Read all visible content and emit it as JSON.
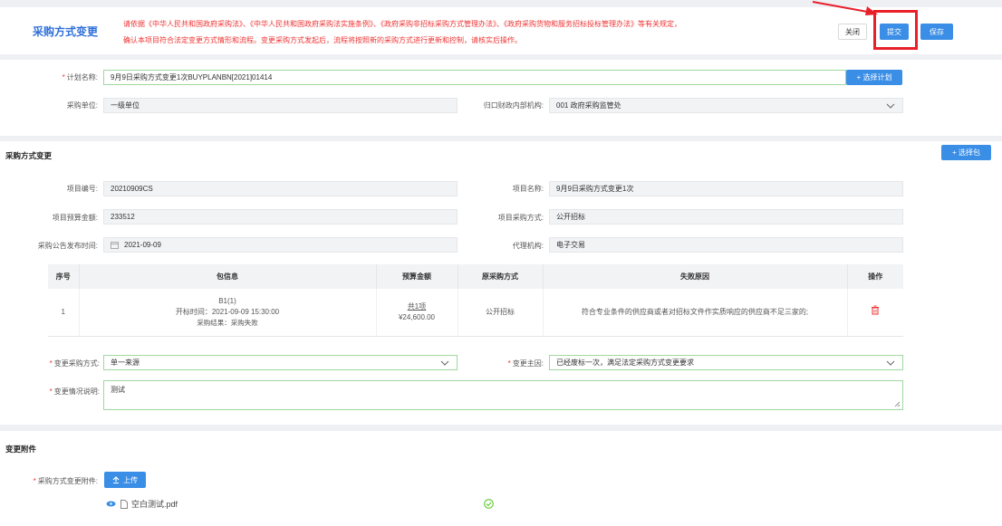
{
  "header": {
    "title": "采购方式变更",
    "notice_line1": "请依据《中华人民共和国政府采购法》、《中华人民共和国政府采购法实施条例》、《政府采购非招标采购方式管理办法》、《政府采购货物和服务招标投标管理办法》等有关规定，",
    "notice_line2": "确认本项目符合法定变更方式情形和流程。变更采购方式发起后，流程将按照新的采购方式进行更新和控制，请核实后操作。",
    "close_label": "关闭",
    "submit_label": "提交",
    "save_label": "保存"
  },
  "plan": {
    "name_label": "计划名称:",
    "name_value": "9月9日采购方式变更1次BUYPLANBN[2021]01414",
    "select_plan_label": "+ 选择计划",
    "unit_label": "采购单位:",
    "unit_value": "一级单位",
    "finance_label": "归口财政内部机构:",
    "finance_value": "001 政府采购监管处"
  },
  "change": {
    "section_title": "采购方式变更",
    "select_package_label": "+ 选择包",
    "project_no_label": "项目编号:",
    "project_no_value": "20210909CS",
    "project_name_label": "项目名称:",
    "project_name_value": "9月9日采购方式变更1次",
    "budget_label": "项目预算金额:",
    "budget_value": "233512",
    "method_label": "项目采购方式:",
    "method_value": "公开招标",
    "publish_label": "采购公告发布时间:",
    "publish_value": "2021-09-09",
    "agency_label": "代理机构:",
    "agency_value": "电子交易",
    "table": {
      "headers": [
        "序号",
        "包信息",
        "预算金额",
        "原采购方式",
        "失败原因",
        "操作"
      ],
      "row": {
        "index": "1",
        "pkg_name": "B1(1)",
        "pkg_open": "开标时间：2021-09-09 15:30:00",
        "pkg_result": "采购结果：采购失败",
        "budget_link": "共1项",
        "budget_amount": "¥24,600.00",
        "orig_method": "公开招标",
        "fail_reason": "符合专业条件的供应商或者对招标文件作实质响应的供应商不足三家的;"
      }
    },
    "new_method_label": "变更采购方式:",
    "new_method_value": "单一来源",
    "reason_label": "变更主因:",
    "reason_value": "已经废标一次，满足法定采购方式变更要求",
    "desc_label": "变更情况说明:",
    "desc_value": "测试"
  },
  "attachment": {
    "section_title": "变更附件",
    "upload_field_label": "采购方式变更附件:",
    "upload_label": "上传",
    "file_name": "空白测试.pdf"
  },
  "colors": {
    "primary": "#3a8ee6",
    "danger": "#e33",
    "highlight": "#e8202a",
    "success": "#52c41a"
  }
}
